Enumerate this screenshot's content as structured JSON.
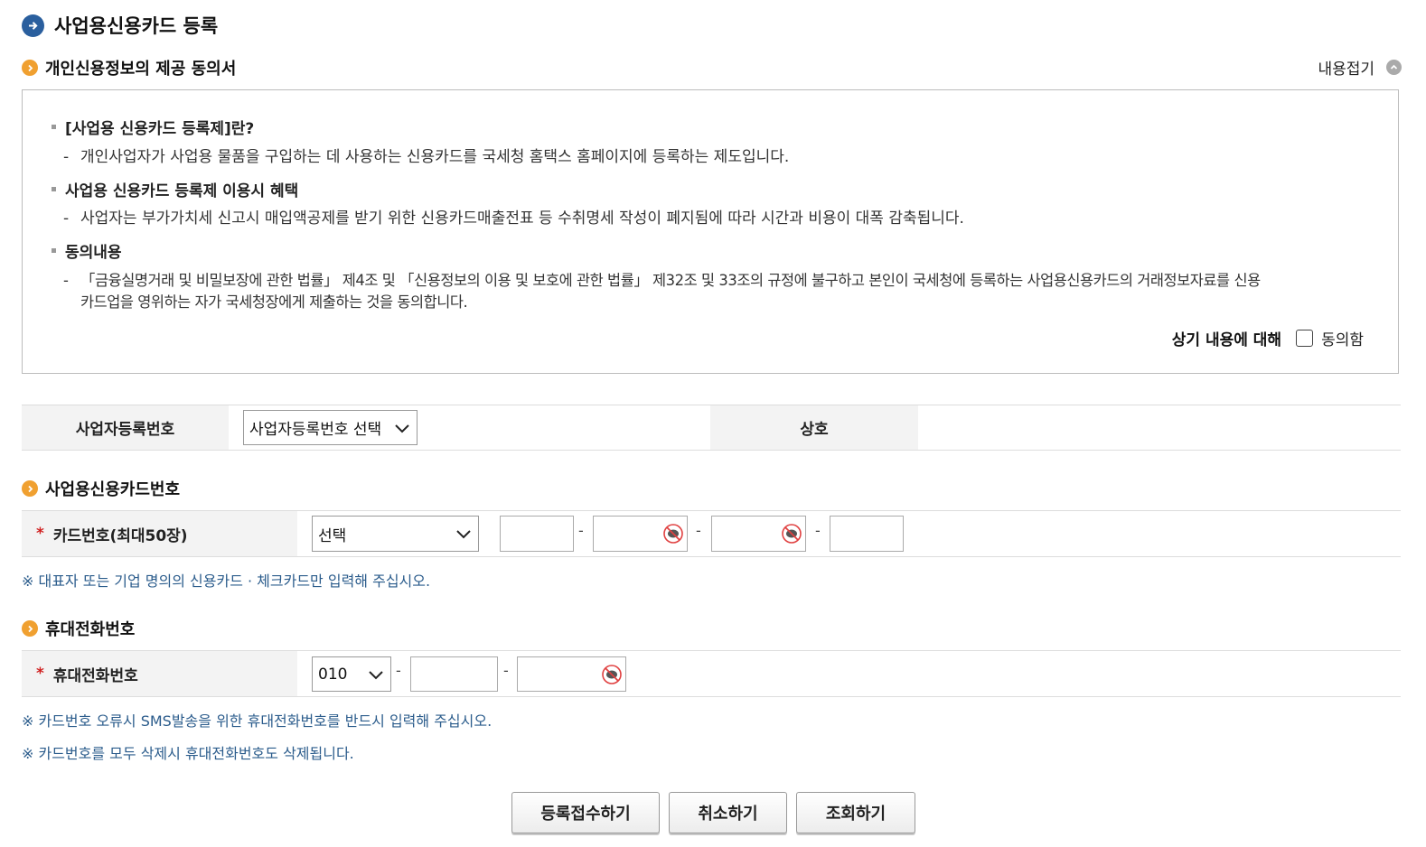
{
  "page": {
    "title": "사업용신용카드 등록"
  },
  "consent": {
    "heading": "개인신용정보의 제공 동의서",
    "collapse_label": "내용접기",
    "items": [
      {
        "title": "[사업용 신용카드 등록제]란?",
        "lines": [
          "개인사업자가 사업용 물품을 구입하는 데 사용하는 신용카드를 국세청 홈택스 홈페이지에 등록하는 제도입니다."
        ]
      },
      {
        "title": "사업용 신용카드 등록제 이용시 혜택",
        "lines": [
          "사업자는 부가가치세 신고시 매입액공제를 받기 위한 신용카드매출전표 등 수취명세 작성이 폐지됨에 따라 시간과 비용이 대폭 감축됩니다."
        ]
      },
      {
        "title": "동의내용",
        "lines": [
          "「금융실명거래 및 비밀보장에 관한 법률」 제4조 및 「신용정보의 이용 및 보호에 관한 법률」 제32조 및 33조의 규정에 불구하고 본인이 국세청에 등록하는 사업용신용카드의   거래정보자료를 신용",
          "카드업을 영위하는 자가 국세청장에게 제출하는 것을 동의합니다."
        ]
      }
    ],
    "dash": "-",
    "agree_prefix": "상기 내용에 대해",
    "agree_label": "동의함"
  },
  "business": {
    "reg_no_label": "사업자등록번호",
    "reg_no_select": "사업자등록번호 선택",
    "name_label": "상호",
    "name_value": ""
  },
  "card": {
    "section_title": "사업용신용카드번호",
    "required_mark": "*",
    "label": "카드번호(최대50장)",
    "select_value": "선택",
    "separator": "-",
    "note": "※ 대표자 또는 기업 명의의 신용카드 · 체크카드만 입력해 주십시오."
  },
  "phone": {
    "section_title": "휴대전화번호",
    "required_mark": "*",
    "label": "휴대전화번호",
    "prefix_select": "010",
    "separator": "-",
    "notes": [
      "※ 카드번호 오류시 SMS발송을 위한 휴대전화번호를 반드시 입력해 주십시오.",
      "※ 카드번호를 모두 삭제시 휴대전화번호도 삭제됩니다."
    ]
  },
  "buttons": {
    "submit": "등록접수하기",
    "cancel": "취소하기",
    "inquiry": "조회하기"
  },
  "colors": {
    "title_icon": "#2a5f9e",
    "section_dot": "#f0a030",
    "note_text": "#2b5c8c",
    "required": "#d02020"
  },
  "icons": {
    "title": "arrow-right-circle-icon",
    "section": "orange-arrow-icon",
    "collapse": "chevron-up-circle-icon",
    "eye": "eye-slash-icon"
  }
}
